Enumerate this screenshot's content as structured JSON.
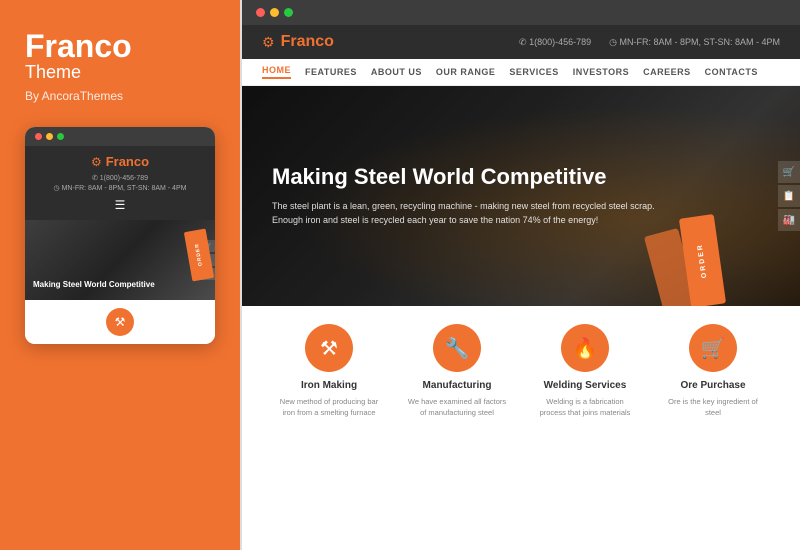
{
  "left": {
    "brand": "Franco",
    "theme": "Theme",
    "by": "By AncoraThemes"
  },
  "mobile": {
    "logo_icon": "⚙",
    "logo_text": "Franco",
    "phone": "✆ 1(800)-456-789",
    "hours": "◷ MN-FR: 8AM - 8PM, ST-SN: 8AM - 4PM",
    "hero_text": "Making Steel World Competitive",
    "card_text": "ORDER"
  },
  "desktop_bar": {
    "dots": [
      "•",
      "•",
      "•"
    ]
  },
  "site": {
    "logo_icon": "⚙",
    "logo_text": "Franco",
    "phone": "✆ 1(800)-456-789",
    "hours": "◷ MN-FR: 8AM - 8PM, ST-SN: 8AM - 4PM",
    "nav": [
      {
        "label": "HOME",
        "active": true
      },
      {
        "label": "FEATURES",
        "active": false
      },
      {
        "label": "ABOUT US",
        "active": false
      },
      {
        "label": "OUR RANGE",
        "active": false
      },
      {
        "label": "SERVICES",
        "active": false
      },
      {
        "label": "INVESTORS",
        "active": false
      },
      {
        "label": "CAREERS",
        "active": false
      },
      {
        "label": "CONTACTS",
        "active": false
      }
    ],
    "hero_title": "Making Steel World Competitive",
    "hero_desc_line1": "The steel plant is a lean, green, recycling machine - making new steel from recycled steel scrap.",
    "hero_desc_line2": "Enough iron and steel is recycled each year to save the nation 74% of the energy!",
    "hero_card_text": "ORDER",
    "services": [
      {
        "icon": "⚒",
        "name": "Iron Making",
        "desc": "New method of producing bar iron from a smelting furnace"
      },
      {
        "icon": "🔧",
        "name": "Manufacturing",
        "desc": "We have examined all factors of manufacturing steel"
      },
      {
        "icon": "🔥",
        "name": "Welding Services",
        "desc": "Welding is a fabrication process that joins materials"
      },
      {
        "icon": "🛒",
        "name": "Ore Purchase",
        "desc": "Ore is the key ingredient of steel"
      }
    ]
  }
}
